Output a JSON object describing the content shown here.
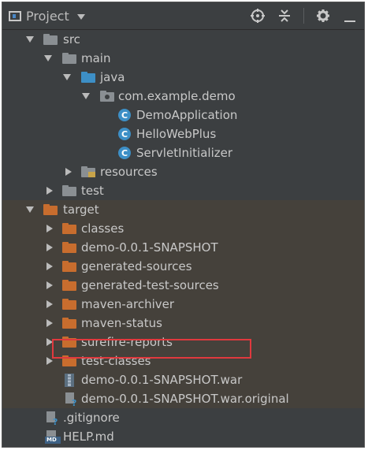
{
  "header": {
    "title": "Project",
    "icons": [
      "project-icon",
      "dropdown-arrow-icon",
      "locate-target-icon",
      "collapse-all-icon",
      "gear-icon",
      "hide-icon"
    ]
  },
  "tree": {
    "src": "src",
    "main": "main",
    "java": "java",
    "package": "com.example.demo",
    "demo_application": "DemoApplication",
    "hello_web_plus": "HelloWebPlus",
    "servlet_initializer": "ServletInitializer",
    "resources": "resources",
    "test": "test",
    "target": "target",
    "classes": "classes",
    "demo_snapshot_dir": "demo-0.0.1-SNAPSHOT",
    "generated_sources": "generated-sources",
    "generated_test_sources": "generated-test-sources",
    "maven_archiver": "maven-archiver",
    "maven_status": "maven-status",
    "surefire_reports": "surefire-reports",
    "test_classes": "test-classes",
    "war_file": "demo-0.0.1-SNAPSHOT.war",
    "war_original": "demo-0.0.1-SNAPSHOT.war.original",
    "gitignore": ".gitignore",
    "help_md": "HELP.md"
  },
  "class_icon_letter": "C",
  "md_badge": "MD",
  "colors": {
    "panel_bg": "#3c3f41",
    "target_bg": "#45413b",
    "folder_orange": "#c86d2e",
    "folder_blue": "#3d8fc6",
    "highlight_red": "#e0393e"
  }
}
